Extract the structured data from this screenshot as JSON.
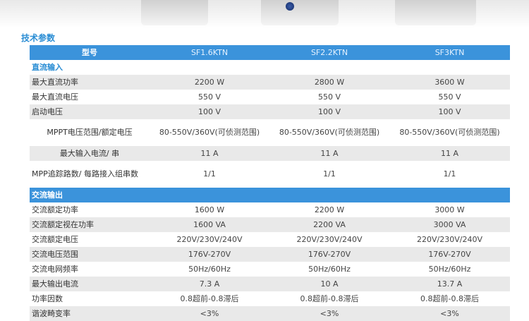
{
  "section_title": "技术参数",
  "table": {
    "header": [
      "型号",
      "SF1.6KTN",
      "SF2.2KTN",
      "SF3KTN"
    ],
    "groups": [
      {
        "title": "直流输入",
        "rows": [
          {
            "label": "最大直流功率",
            "values": [
              "2200 W",
              "2800 W",
              "3600 W"
            ]
          },
          {
            "label": "最大直流电压",
            "values": [
              "550 V",
              "550 V",
              "550 V"
            ]
          },
          {
            "label": "启动电压",
            "values": [
              "100 V",
              "100 V",
              "100 V"
            ]
          },
          {
            "label": "MPPT电压范围/额定电压",
            "values": [
              "80-550V/360V(可侦测范围)",
              "80-550V/360V(可侦测范围)",
              "80-550V/360V(可侦测范围)"
            ]
          },
          {
            "label": "最大输入电流/ 串",
            "values": [
              "11 A",
              "11 A",
              "11 A"
            ]
          },
          {
            "label": "MPP追踪路数/ 每路接入组串数",
            "values": [
              "1/1",
              "1/1",
              "1/1"
            ]
          }
        ]
      },
      {
        "title": "交流输出",
        "rows": [
          {
            "label": "交流额定功率",
            "values": [
              "1600 W",
              "2200 W",
              "3000 W"
            ]
          },
          {
            "label": "交流额定视在功率",
            "values": [
              "1600 VA",
              "2200 VA",
              "3000 VA"
            ]
          },
          {
            "label": "交流额定电压",
            "values": [
              "220V/230V/240V",
              "220V/230V/240V",
              "220V/230V/240V"
            ]
          },
          {
            "label": "交流电压范围",
            "values": [
              "176V-270V",
              "176V-270V",
              "176V-270V"
            ]
          },
          {
            "label": "交流电网频率",
            "values": [
              "50Hz/60Hz",
              "50Hz/60Hz",
              "50Hz/60Hz"
            ]
          },
          {
            "label": "最大输出电流",
            "values": [
              "7.3 A",
              "10 A",
              "13.7 A"
            ]
          },
          {
            "label": "功率因数",
            "values": [
              "0.8超前-0.8滞后",
              "0.8超前-0.8滞后",
              "0.8超前-0.8滞后"
            ]
          },
          {
            "label": "谐波畸变率",
            "values": [
              "<3%",
              "<3%",
              "<3%"
            ]
          }
        ]
      }
    ]
  }
}
